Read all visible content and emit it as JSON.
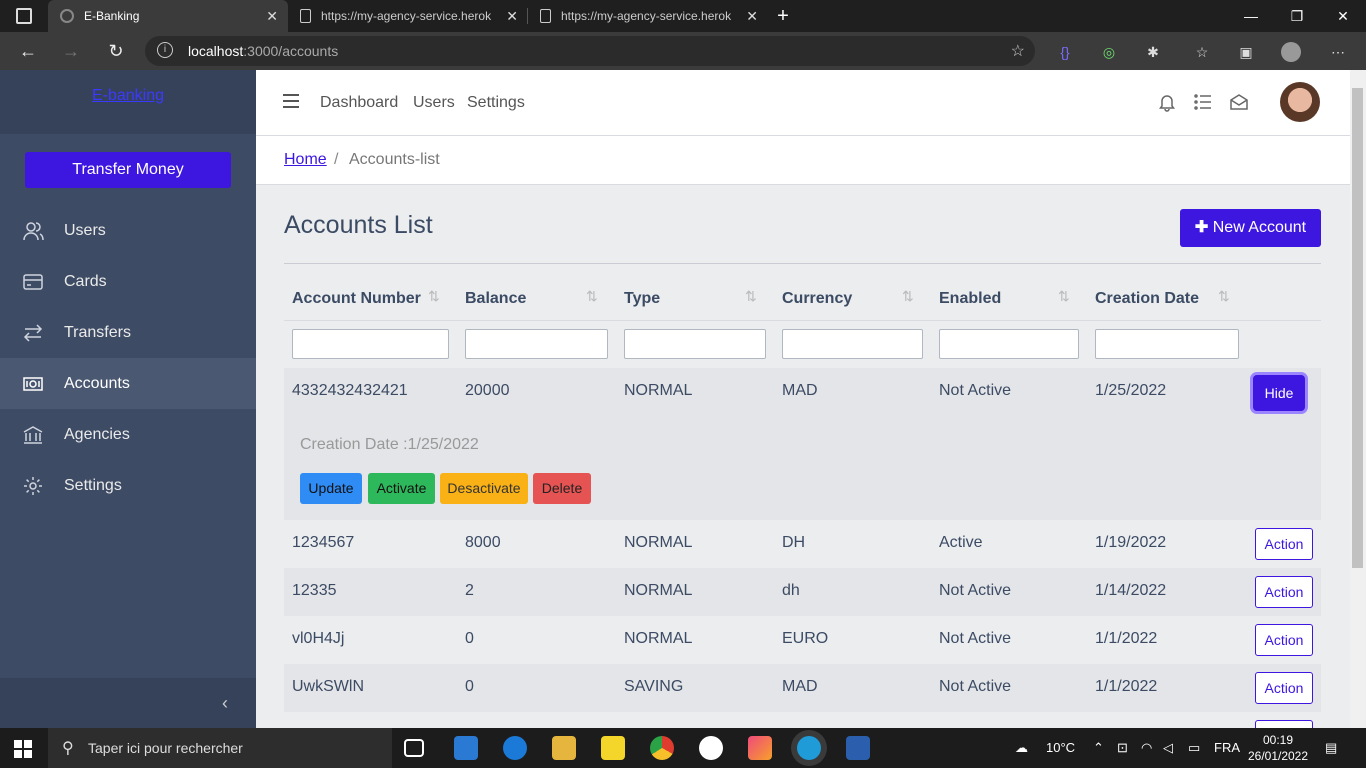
{
  "browser": {
    "tabs": [
      {
        "title": "E-Banking",
        "active": true
      },
      {
        "title": "https://my-agency-service.herok",
        "active": false
      },
      {
        "title": "https://my-agency-service.herok",
        "active": false
      }
    ],
    "url_host": "localhost",
    "url_path": ":3000/accounts"
  },
  "sidebar": {
    "brand": "E-banking",
    "transfer_button": "Transfer Money",
    "items": [
      {
        "label": "Users",
        "icon": "users-icon"
      },
      {
        "label": "Cards",
        "icon": "credit-card-icon"
      },
      {
        "label": "Transfers",
        "icon": "transfer-arrows-icon"
      },
      {
        "label": "Accounts",
        "icon": "money-bill-icon"
      },
      {
        "label": "Agencies",
        "icon": "bank-icon"
      },
      {
        "label": "Settings",
        "icon": "gear-icon"
      }
    ],
    "active_item": "Accounts"
  },
  "topnav": {
    "links": [
      "Dashboard",
      "Users",
      "Settings"
    ]
  },
  "breadcrumb": {
    "home": "Home",
    "separator": "/",
    "current": "Accounts-list"
  },
  "page": {
    "title": "Accounts List",
    "new_button": "New Account"
  },
  "table": {
    "columns": [
      "Account Number",
      "Balance",
      "Type",
      "Currency",
      "Enabled",
      "Creation Date"
    ],
    "expanded_row": {
      "account_number": "4332432432421",
      "balance": "20000",
      "type": "NORMAL",
      "currency": "MAD",
      "enabled": "Not Active",
      "creation_date": "1/25/2022",
      "hide_label": "Hide",
      "details_text": "Creation Date :1/25/2022",
      "buttons": [
        "Update",
        "Activate",
        "Desactivate",
        "Delete"
      ]
    },
    "rows": [
      {
        "account_number": "1234567",
        "balance": "8000",
        "type": "NORMAL",
        "currency": "DH",
        "enabled": "Active",
        "creation_date": "1/19/2022",
        "action": "Action"
      },
      {
        "account_number": "12335",
        "balance": "2",
        "type": "NORMAL",
        "currency": "dh",
        "enabled": "Not Active",
        "creation_date": "1/14/2022",
        "action": "Action"
      },
      {
        "account_number": "vl0H4Jj",
        "balance": "0",
        "type": "NORMAL",
        "currency": "EURO",
        "enabled": "Not Active",
        "creation_date": "1/1/2022",
        "action": "Action"
      },
      {
        "account_number": "UwkSWlN",
        "balance": "0",
        "type": "SAVING",
        "currency": "MAD",
        "enabled": "Not Active",
        "creation_date": "1/1/2022",
        "action": "Action"
      }
    ]
  },
  "taskbar": {
    "search_placeholder": "Taper ici pour rechercher",
    "temperature": "10°C",
    "language": "FRA",
    "time": "00:19",
    "date": "26/01/2022"
  },
  "colors": {
    "primary": "#3d16e0",
    "sidebar": "#3d4b64",
    "info": "#2f8cf4",
    "success": "#2eb85c",
    "warning": "#f9b115",
    "danger": "#e55353"
  }
}
